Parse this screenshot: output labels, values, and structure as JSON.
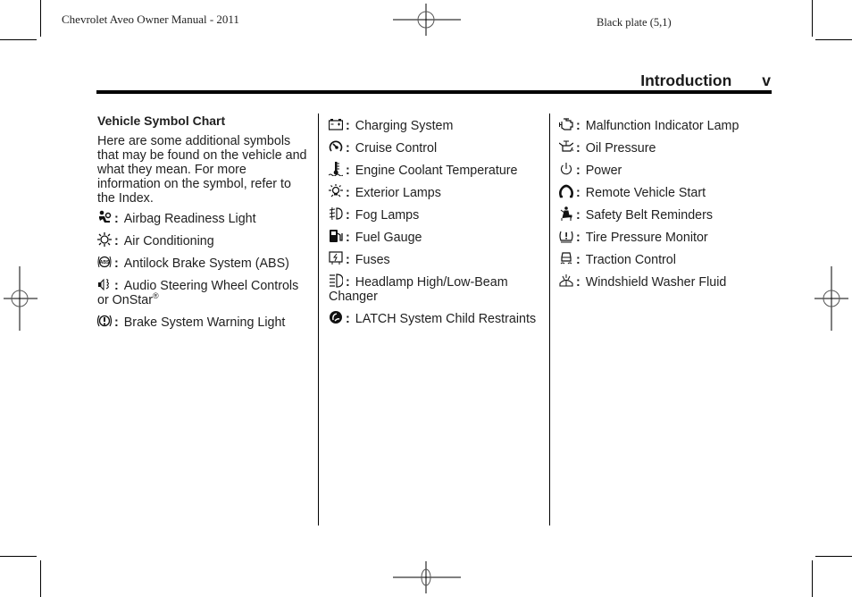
{
  "header": {
    "manual_title": "Chevrolet Aveo Owner Manual - 2011",
    "plate": "Black plate (5,1)"
  },
  "section": {
    "title": "Introduction",
    "page": "v"
  },
  "intro": {
    "heading": "Vehicle Symbol Chart",
    "text": "Here are some additional symbols that may be found on the vehicle and what they mean. For more information on the symbol, refer to the Index."
  },
  "columns": [
    {
      "items": [
        {
          "icon": "airbag-icon",
          "label": "Airbag Readiness Light"
        },
        {
          "icon": "air-conditioning-icon",
          "label": "Air Conditioning"
        },
        {
          "icon": "abs-icon",
          "label": "Antilock Brake System (ABS)"
        },
        {
          "icon": "audio-steering-icon",
          "label": "Audio Steering Wheel Controls or OnStar",
          "suffix": "®"
        },
        {
          "icon": "brake-warning-icon",
          "label": "Brake System Warning Light"
        }
      ]
    },
    {
      "items": [
        {
          "icon": "battery-icon",
          "label": "Charging System"
        },
        {
          "icon": "cruise-control-icon",
          "label": "Cruise Control"
        },
        {
          "icon": "coolant-temperature-icon",
          "label": "Engine Coolant Temperature"
        },
        {
          "icon": "exterior-lamps-icon",
          "label": "Exterior Lamps"
        },
        {
          "icon": "fog-lamps-icon",
          "label": "Fog Lamps"
        },
        {
          "icon": "fuel-gauge-icon",
          "label": "Fuel Gauge"
        },
        {
          "icon": "fuses-icon",
          "label": "Fuses"
        },
        {
          "icon": "headlamp-beam-icon",
          "label": "Headlamp High/Low-Beam Changer"
        },
        {
          "icon": "latch-child-restraint-icon",
          "label": "LATCH System Child Restraints"
        }
      ]
    },
    {
      "items": [
        {
          "icon": "engine-malfunction-icon",
          "label": "Malfunction Indicator Lamp"
        },
        {
          "icon": "oil-pressure-icon",
          "label": "Oil Pressure"
        },
        {
          "icon": "power-icon",
          "label": "Power"
        },
        {
          "icon": "remote-start-icon",
          "label": "Remote Vehicle Start"
        },
        {
          "icon": "safety-belt-icon",
          "label": "Safety Belt Reminders"
        },
        {
          "icon": "tire-pressure-icon",
          "label": "Tire Pressure Monitor"
        },
        {
          "icon": "traction-control-icon",
          "label": "Traction Control"
        },
        {
          "icon": "washer-fluid-icon",
          "label": "Windshield Washer Fluid"
        }
      ]
    }
  ]
}
